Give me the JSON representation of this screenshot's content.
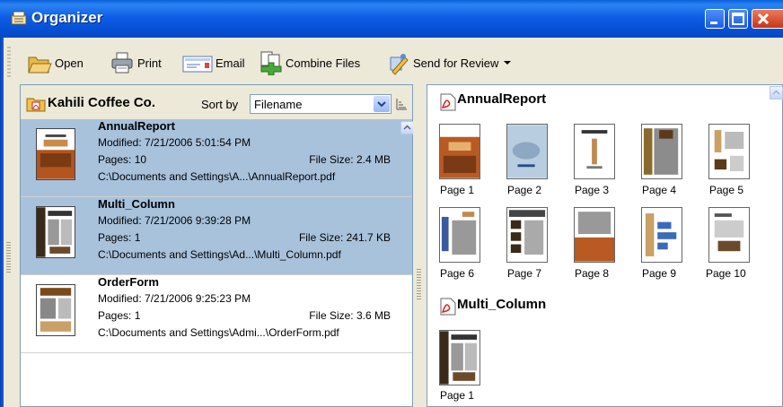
{
  "window": {
    "title": "Organizer",
    "colors": {
      "titlebar": "#0450d4",
      "selection": "#a8c2dc",
      "frame": "#ece9d8"
    }
  },
  "toolbar": {
    "items": [
      {
        "label": "Open",
        "icon": "folder-open-icon"
      },
      {
        "label": "Print",
        "icon": "printer-icon"
      },
      {
        "label": "Email",
        "icon": "envelope-icon"
      },
      {
        "label": "Combine Files",
        "icon": "combine-files-icon"
      },
      {
        "label": "Send for Review",
        "icon": "send-review-icon",
        "dropdown": true
      }
    ]
  },
  "left": {
    "folder_name": "Kahili Coffee Co.",
    "sort_label": "Sort by",
    "sort_value": "Filename",
    "files": [
      {
        "name": "AnnualReport",
        "modified": "Modified: 7/21/2006 5:01:54 PM",
        "pages": "Pages: 10",
        "size": "File Size: 2.4 MB",
        "path": "C:\\Documents and Settings\\A...\\AnnualReport.pdf",
        "selected": true
      },
      {
        "name": "Multi_Column",
        "modified": "Modified: 7/21/2006 9:39:28 PM",
        "pages": "Pages: 1",
        "size": "File Size: 241.7 KB",
        "path": "C:\\Documents and Settings\\Ad...\\Multi_Column.pdf",
        "selected": true
      },
      {
        "name": "OrderForm",
        "modified": "Modified: 7/21/2006 9:25:23 PM",
        "pages": "Pages: 1",
        "size": "File Size: 3.6 MB",
        "path": "C:\\Documents and Settings\\Admi...\\OrderForm.pdf",
        "selected": false
      }
    ]
  },
  "right": {
    "documents": [
      {
        "title": "AnnualReport",
        "pages": [
          "Page 1",
          "Page 2",
          "Page 3",
          "Page 4",
          "Page 5",
          "Page 6",
          "Page 7",
          "Page 8",
          "Page 9",
          "Page 10"
        ]
      },
      {
        "title": "Multi_Column",
        "pages": [
          "Page 1"
        ]
      }
    ]
  }
}
